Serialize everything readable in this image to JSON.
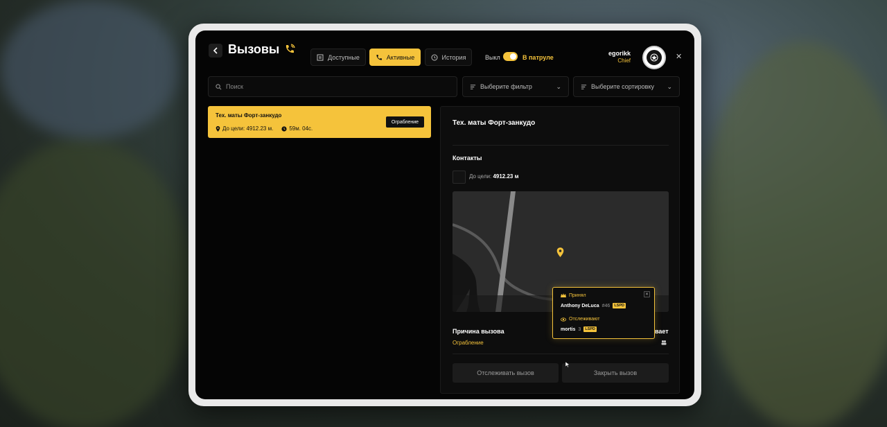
{
  "header": {
    "title": "Вызовы",
    "tabs": [
      {
        "label": "Доступные",
        "icon": "list-icon"
      },
      {
        "label": "Активные",
        "icon": "phone-icon",
        "active": true
      },
      {
        "label": "История",
        "icon": "clock-icon"
      }
    ],
    "patrol_off_label": "Выкл",
    "patrol_on_label": "В патруле",
    "user": {
      "name": "egorikk",
      "role": "Chief"
    }
  },
  "filters": {
    "search_placeholder": "Поиск",
    "filter_placeholder": "Выберите фильтр",
    "sort_placeholder": "Выберите сортировку"
  },
  "calls": [
    {
      "title": "Тех. маты Форт-занкудо",
      "distance": "До цели: 4912.23 м.",
      "time": "59м. 04с.",
      "type": "Ограбление"
    }
  ],
  "detail": {
    "title": "Тех. маты Форт-занкудо",
    "contacts_label": "Контакты",
    "distance_prefix": "До цели:",
    "distance_value": "4912.23 м",
    "reason_label": "Причина вызова",
    "reason_value": "Ограбление",
    "watching_label_partial": "вает",
    "track_button": "Отслеживать вызов",
    "close_button": "Закрыть вызов"
  },
  "popup": {
    "accepted_label": "Принял",
    "accepted_name": "Anthony DeLuca",
    "accepted_id": "#46",
    "accepted_tag": "LSPD",
    "tracking_label": "Отслеживают",
    "tracking_name": "mortis",
    "tracking_count": "3",
    "tracking_tag": "LSPD"
  },
  "colors": {
    "accent": "#f5c33b",
    "panel": "#0d0d0d",
    "background": "#050505"
  }
}
